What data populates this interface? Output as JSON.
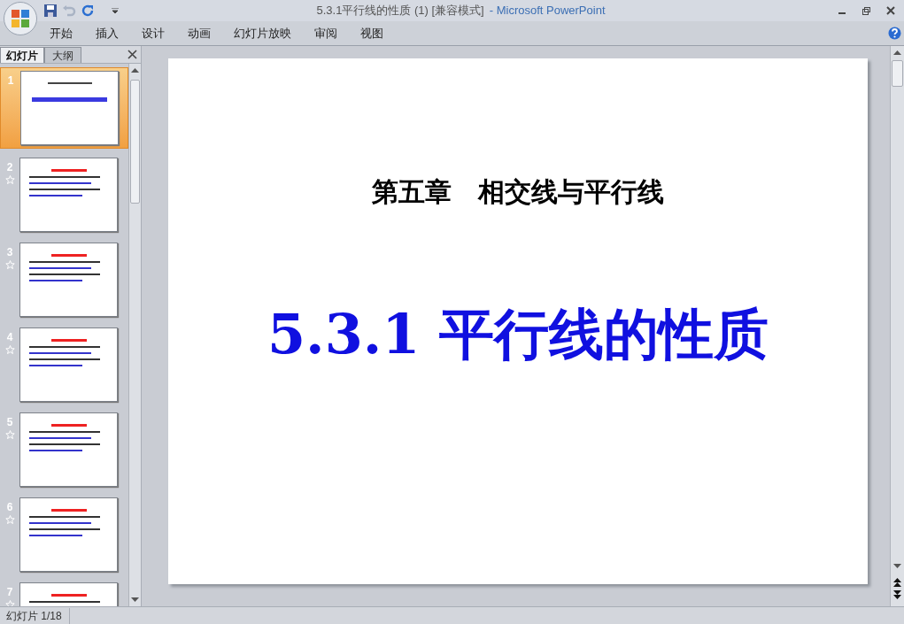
{
  "window": {
    "title": "5.3.1平行线的性质 (1) [兼容模式]",
    "app_name": "- Microsoft PowerPoint"
  },
  "ribbon_tabs": [
    {
      "label": "开始",
      "selected": false
    },
    {
      "label": "插入",
      "selected": false
    },
    {
      "label": "设计",
      "selected": false
    },
    {
      "label": "动画",
      "selected": false
    },
    {
      "label": "幻灯片放映",
      "selected": false
    },
    {
      "label": "审阅",
      "selected": false
    },
    {
      "label": "视图",
      "selected": false
    }
  ],
  "pane_tabs": [
    {
      "label": "幻灯片",
      "selected": true
    },
    {
      "label": "大纲",
      "selected": false
    }
  ],
  "thumbnails": [
    {
      "number": "1",
      "selected": true,
      "animated": false
    },
    {
      "number": "2",
      "selected": false,
      "animated": true
    },
    {
      "number": "3",
      "selected": false,
      "animated": true
    },
    {
      "number": "4",
      "selected": false,
      "animated": true
    },
    {
      "number": "5",
      "selected": false,
      "animated": true
    },
    {
      "number": "6",
      "selected": false,
      "animated": true
    },
    {
      "number": "7",
      "selected": false,
      "animated": true
    }
  ],
  "slide": {
    "heading": "第五章　相交线与平行线",
    "title": "5.3.1 平行线的性质"
  },
  "status_bar": {
    "slide_counter": "幻灯片 1/18"
  }
}
